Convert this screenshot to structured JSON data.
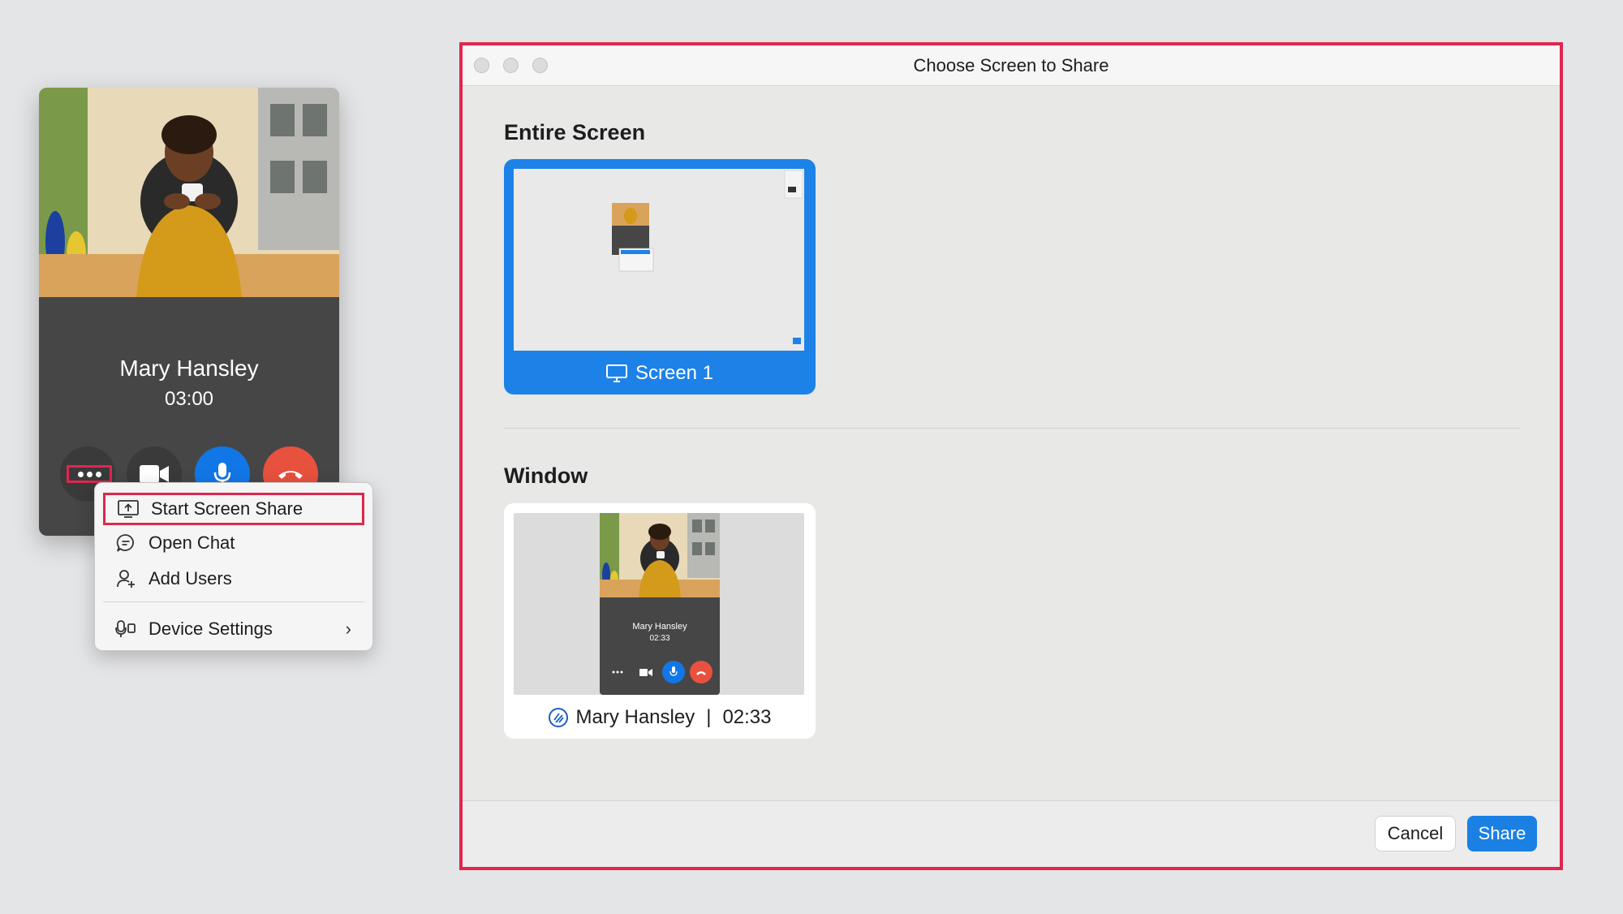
{
  "call": {
    "name": "Mary Hansley",
    "timer": "03:00"
  },
  "menu": {
    "items": [
      {
        "label": "Start Screen Share",
        "icon": "screen-share-icon"
      },
      {
        "label": "Open Chat",
        "icon": "chat-bubble-icon"
      },
      {
        "label": "Add Users",
        "icon": "add-user-icon"
      },
      {
        "label": "Device Settings",
        "icon": "device-settings-icon"
      }
    ]
  },
  "dialog": {
    "title": "Choose Screen to Share",
    "entire_screen_heading": "Entire Screen",
    "screen_label": "Screen 1",
    "window_heading": "Window",
    "window_title": "Mary Hansley",
    "window_separator": "|",
    "window_time": "02:33",
    "mini_name": "Mary Hansley",
    "mini_time": "02:33",
    "cancel_label": "Cancel",
    "share_label": "Share"
  },
  "colors": {
    "highlight": "#e0264d",
    "accent": "#1b80e4",
    "hangup": "#e8513e"
  }
}
